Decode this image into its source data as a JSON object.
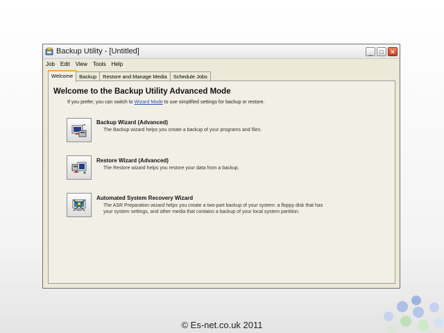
{
  "window": {
    "title": "Backup Utility - [Untitled]",
    "buttons": {
      "minimize": "_",
      "maximize": "□",
      "close": "✕"
    }
  },
  "menu": [
    "Job",
    "Edit",
    "View",
    "Tools",
    "Help"
  ],
  "tabs": [
    "Welcome",
    "Backup",
    "Restore and Manage Media",
    "Schedule Jobs"
  ],
  "active_tab": "Welcome",
  "welcome": {
    "heading": "Welcome to the Backup Utility Advanced Mode",
    "intro_before": "If you prefer, you can switch to ",
    "intro_link": "Wizard Mode",
    "intro_after": " to use simplified settings for backup or restore."
  },
  "wizards": [
    {
      "title": "Backup Wizard (Advanced)",
      "description": "The Backup wizard helps you create a backup of your programs and files.",
      "icon": "backup-icon"
    },
    {
      "title": "Restore Wizard (Advanced)",
      "description": "The Restore wizard helps you restore your data from a backup.",
      "icon": "restore-icon"
    },
    {
      "title": "Automated System Recovery Wizard",
      "description": "The ASR Preparation wizard helps you create a two-part backup of your system: a floppy disk that has your system settings, and other media that contains a backup of your local system partition.",
      "icon": "asr-icon"
    }
  ],
  "footer": {
    "copyright": "© Es-net.co.uk 2011"
  },
  "colors": {
    "window_bg": "#ece9d8",
    "link": "#2a53b5",
    "close_button": "#c4391c",
    "tab_highlight": "#f2a93b"
  }
}
